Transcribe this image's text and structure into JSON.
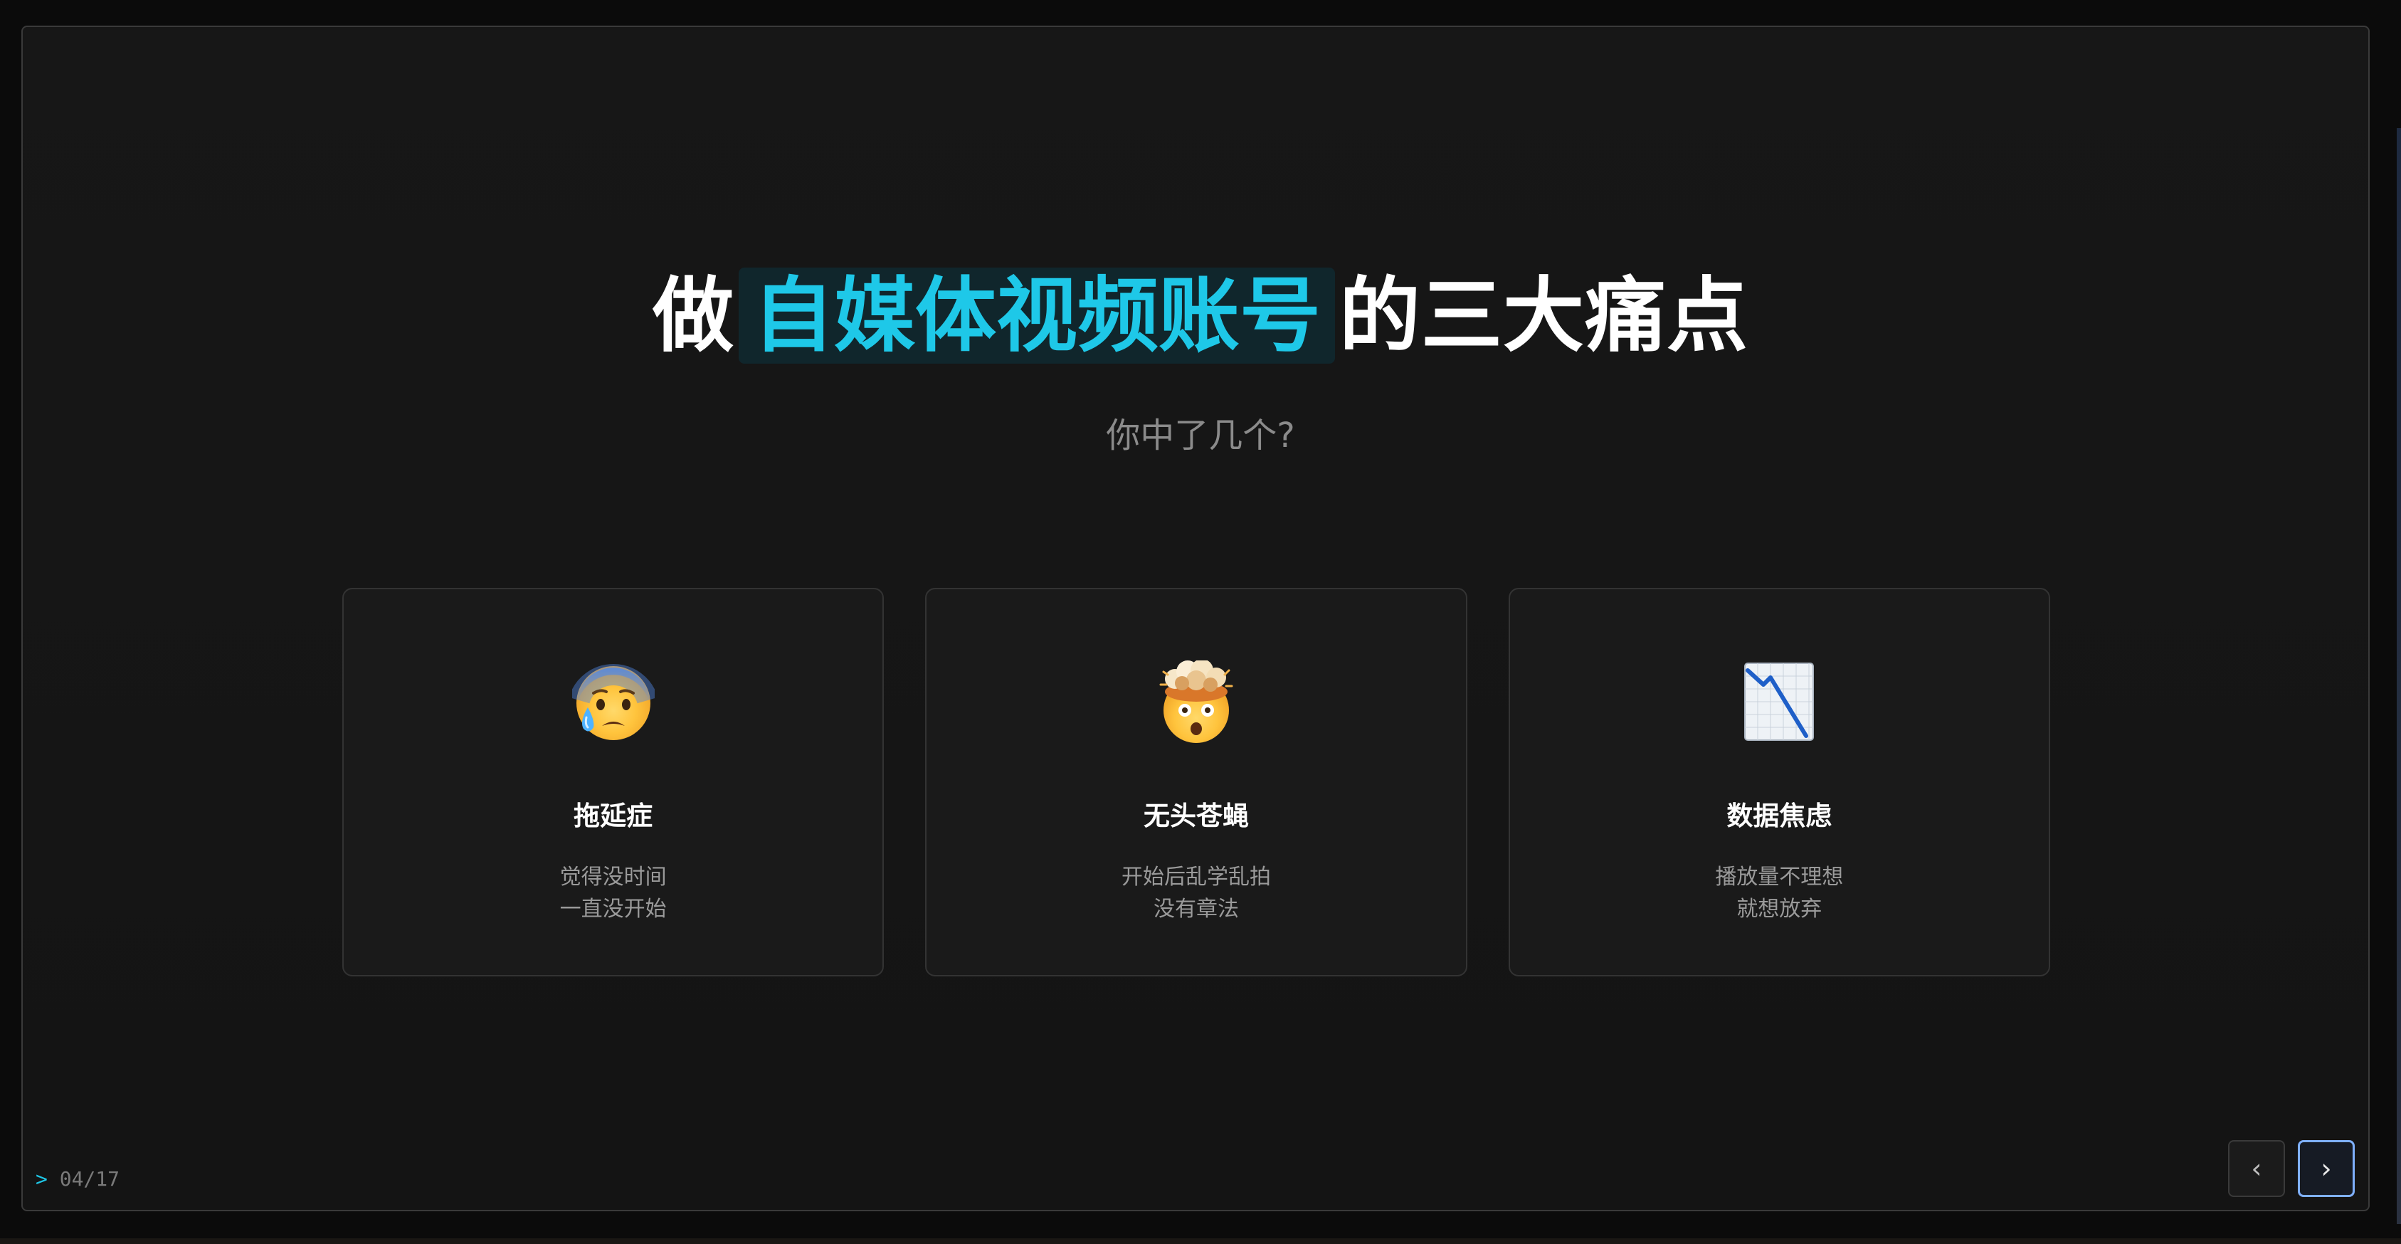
{
  "slide": {
    "title_before": "做",
    "title_highlight": "自媒体视频账号",
    "title_after": "的三大痛点",
    "subtitle": "你中了几个?"
  },
  "cards": [
    {
      "icon": "anxious-face-with-sweat-icon",
      "title": "拖延症",
      "desc_line1": "觉得没时间",
      "desc_line2": "一直没开始"
    },
    {
      "icon": "exploding-head-icon",
      "title": "无头苍蝇",
      "desc_line1": "开始后乱学乱拍",
      "desc_line2": "没有章法"
    },
    {
      "icon": "chart-decreasing-icon",
      "title": "数据焦虑",
      "desc_line1": "播放量不理想",
      "desc_line2": "就想放弃"
    }
  ],
  "footer": {
    "prompt": ">",
    "page": "04/17",
    "prev_label": "‹",
    "next_label": "›"
  },
  "colors": {
    "accent": "#1ec8e8",
    "background": "#141414",
    "card_border": "#333333",
    "focus_ring": "#7fb0ff"
  }
}
